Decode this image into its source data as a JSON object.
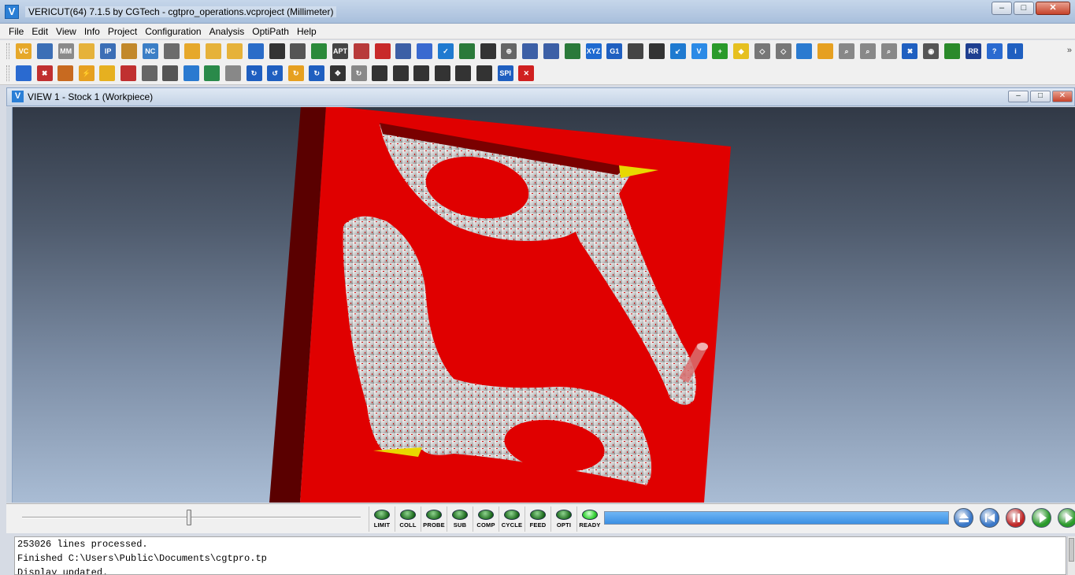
{
  "window": {
    "title": "VERICUT(64)  7.1.5 by CGTech - cgtpro_operations.vcproject (Millimeter)",
    "icon_letter": "V",
    "minimize": "–",
    "maximize": "□",
    "close": "✕"
  },
  "menu": [
    "File",
    "Edit",
    "View",
    "Info",
    "Project",
    "Configuration",
    "Analysis",
    "OptiPath",
    "Help"
  ],
  "toolbar1": [
    {
      "icon": "open-project-icon",
      "color": "#e6a82a",
      "text": "VC"
    },
    {
      "icon": "save-project-icon",
      "color": "#3c6fb6",
      "text": ""
    },
    {
      "icon": "save-mm-icon",
      "color": "#8a8a8a",
      "text": "MM"
    },
    {
      "icon": "open-folder-icon",
      "color": "#e6b23a",
      "text": ""
    },
    {
      "icon": "save-ip-icon",
      "color": "#3c6fb6",
      "text": "IP"
    },
    {
      "icon": "import-icon",
      "color": "#c2882a",
      "text": ""
    },
    {
      "icon": "nc-program-icon",
      "color": "#3c7fc6",
      "text": "NC"
    },
    {
      "icon": "document-icon",
      "color": "#6b6b6b",
      "text": ""
    },
    {
      "icon": "save-as-icon",
      "color": "#e6a82a",
      "text": ""
    },
    {
      "icon": "open-file-icon",
      "color": "#e6b23a",
      "text": ""
    },
    {
      "icon": "open-folder-2-icon",
      "color": "#e6b23a",
      "text": ""
    },
    {
      "icon": "tool-manager-icon",
      "color": "#2a6cc8",
      "text": ""
    },
    {
      "icon": "export-icon",
      "color": "#333333",
      "text": ""
    },
    {
      "icon": "machine-icon",
      "color": "#555555",
      "text": ""
    },
    {
      "icon": "structure-icon",
      "color": "#2b8a3a",
      "text": ""
    },
    {
      "icon": "apt-icon",
      "color": "#444444",
      "text": "APT"
    },
    {
      "icon": "report-icon",
      "color": "#b83a3a",
      "text": ""
    },
    {
      "icon": "sphere-icon",
      "color": "#c82a2a",
      "text": ""
    },
    {
      "icon": "save-disk-icon",
      "color": "#3c5fa6",
      "text": ""
    },
    {
      "icon": "globe-icon",
      "color": "#3a6ad0",
      "text": ""
    },
    {
      "icon": "check-shield-icon",
      "color": "#1f7ad0",
      "text": "✓"
    },
    {
      "icon": "table-icon",
      "color": "#2b7a3a",
      "text": ""
    },
    {
      "icon": "axis-icon",
      "color": "#333333",
      "text": ""
    },
    {
      "icon": "target-icon",
      "color": "#666666",
      "text": "⊕"
    },
    {
      "icon": "save-2-icon",
      "color": "#3c5fa6",
      "text": ""
    },
    {
      "icon": "save-3-icon",
      "color": "#3c5fa6",
      "text": ""
    },
    {
      "icon": "tree-icon",
      "color": "#2b7a3a",
      "text": ""
    },
    {
      "icon": "xyz-icon",
      "color": "#1f6ad0",
      "text": "XYZ"
    },
    {
      "icon": "g1-icon",
      "color": "#1f5fc0",
      "text": "G1"
    },
    {
      "icon": "list-icon",
      "color": "#444444",
      "text": ""
    },
    {
      "icon": "grid-list-icon",
      "color": "#333333",
      "text": ""
    },
    {
      "icon": "arrow-in-icon",
      "color": "#1f7ad0",
      "text": "↙"
    },
    {
      "icon": "vericut-icon",
      "color": "#2b8ae6",
      "text": "V"
    },
    {
      "icon": "add-green-icon",
      "color": "#2a9a2a",
      "text": "+"
    },
    {
      "icon": "diamond-icon",
      "color": "#e6c020",
      "text": "◆"
    },
    {
      "icon": "diamond-outline-icon",
      "color": "#777777",
      "text": "◇"
    },
    {
      "icon": "diamond-2-icon",
      "color": "#777777",
      "text": "◇"
    },
    {
      "icon": "color-cube-icon",
      "color": "#2a7ad0",
      "text": ""
    },
    {
      "icon": "palette-icon",
      "color": "#e6a020",
      "text": ""
    },
    {
      "icon": "zoom-icon",
      "color": "#888888",
      "text": "⌕"
    },
    {
      "icon": "zoom-in-icon",
      "color": "#888888",
      "text": "⌕"
    },
    {
      "icon": "zoom-out-icon",
      "color": "#888888",
      "text": "⌕"
    },
    {
      "icon": "fit-icon",
      "color": "#1f5fc0",
      "text": "✖"
    },
    {
      "icon": "eye-icon",
      "color": "#555555",
      "text": "◉"
    },
    {
      "icon": "probe-icon",
      "color": "#2a8a2a",
      "text": ""
    },
    {
      "icon": "rr-icon",
      "color": "#1f3f90",
      "text": "RR"
    },
    {
      "icon": "help-doc-icon",
      "color": "#2a6ad0",
      "text": "?"
    },
    {
      "icon": "info-icon",
      "color": "#1f5fc0",
      "text": "i"
    }
  ],
  "toolbar2": [
    {
      "icon": "settings-doc-icon",
      "color": "#2a6ad0",
      "text": ""
    },
    {
      "icon": "delete-doc-icon",
      "color": "#c03030",
      "text": "✖"
    },
    {
      "icon": "stock-icon",
      "color": "#c86a20",
      "text": ""
    },
    {
      "icon": "lightning-icon",
      "color": "#e6a020",
      "text": "⚡"
    },
    {
      "icon": "cube-icon",
      "color": "#e6b020",
      "text": ""
    },
    {
      "icon": "model-icon",
      "color": "#c03030",
      "text": ""
    },
    {
      "icon": "tool-path-icon",
      "color": "#666666",
      "text": ""
    },
    {
      "icon": "machine-2-icon",
      "color": "#555555",
      "text": ""
    },
    {
      "icon": "arrows-icon",
      "color": "#2a7ad0",
      "text": ""
    },
    {
      "icon": "chart-icon",
      "color": "#2a8a4a",
      "text": ""
    },
    {
      "icon": "printer-icon",
      "color": "#888888",
      "text": ""
    },
    {
      "icon": "rotate-x-icon",
      "color": "#1f5fc0",
      "text": "↻"
    },
    {
      "icon": "rotate-y-icon",
      "color": "#1f5fc0",
      "text": "↺"
    },
    {
      "icon": "rotate-icon",
      "color": "#e6a020",
      "text": "↻"
    },
    {
      "icon": "rotate-z-icon",
      "color": "#1f5fc0",
      "text": "↻"
    },
    {
      "icon": "pan-icon",
      "color": "#333333",
      "text": "✥"
    },
    {
      "icon": "spin-icon",
      "color": "#888888",
      "text": "↻"
    },
    {
      "icon": "layout-single-icon",
      "color": "#333333",
      "text": ""
    },
    {
      "icon": "layout-vsplit-icon",
      "color": "#333333",
      "text": ""
    },
    {
      "icon": "layout-hsplit-icon",
      "color": "#333333",
      "text": ""
    },
    {
      "icon": "layout-three-icon",
      "color": "#333333",
      "text": ""
    },
    {
      "icon": "layout-three-2-icon",
      "color": "#333333",
      "text": ""
    },
    {
      "icon": "layout-four-icon",
      "color": "#333333",
      "text": ""
    },
    {
      "icon": "spi-icon",
      "color": "#1f5fc0",
      "text": "SPI"
    },
    {
      "icon": "close-red-icon",
      "color": "#d02020",
      "text": "✕"
    }
  ],
  "view": {
    "title": "VIEW 1 - Stock 1 (Workpiece)",
    "icon_letter": "V"
  },
  "leds": [
    "LIMIT",
    "COLL",
    "PROBE",
    "SUB",
    "COMP",
    "CYCLE",
    "FEED",
    "OPTI",
    "READY"
  ],
  "progress_fraction": 1.0,
  "playback": [
    {
      "name": "eject-button",
      "color": "#3a78c8"
    },
    {
      "name": "rewind-button",
      "color": "#3a78c8"
    },
    {
      "name": "stop-button",
      "color": "#c02828"
    },
    {
      "name": "play-button",
      "color": "#2a9a2a"
    },
    {
      "name": "play-to-end-button",
      "color": "#2a9a2a"
    }
  ],
  "log": [
    "253026 lines processed.",
    "Finished C:\\Users\\Public\\Documents\\cgtpro.tp",
    "Display updated."
  ]
}
